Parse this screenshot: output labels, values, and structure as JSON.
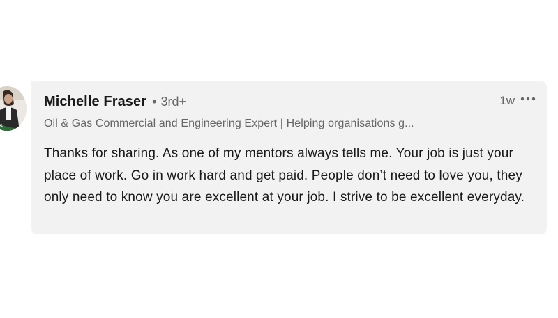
{
  "comment": {
    "author": {
      "name": "Michelle Fraser",
      "separator": "•",
      "degree": "3rd+",
      "headline": "Oil & Gas Commercial and Engineering Expert | Helping organisations g..."
    },
    "timestamp": "1w",
    "more_icon": "ellipsis-icon",
    "text": "Thanks for sharing. As one of my mentors always tells me. Your job is just your place of work. Go in work hard and get paid. People don’t need to love you, they only need to know you are excellent at your job. I strive to be excellent everyday."
  },
  "colors": {
    "bubble_background": "#f2f2f2",
    "name": "#191919",
    "secondary_text": "#666666"
  }
}
